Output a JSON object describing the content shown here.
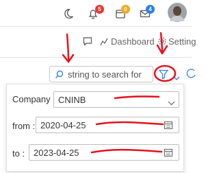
{
  "header": {
    "badges": {
      "notifications": "5",
      "tasks": "0",
      "messages": "4"
    },
    "badge_colors": {
      "notifications": "#e53935",
      "tasks": "#f5a623",
      "messages": "#2f80ed"
    }
  },
  "nav": {
    "dashboard_label": "Dashboard",
    "settings_label": "Setting"
  },
  "search": {
    "placeholder": "string to search for"
  },
  "filters": {
    "company_label": "Company :",
    "company_value": "CNINB",
    "from_label": "from :",
    "from_value": "2020-04-25",
    "to_label": "to :",
    "to_value": "2023-04-25"
  },
  "icons": [
    "moon-icon",
    "bell-icon",
    "calendar-icon",
    "mail-icon",
    "avatar",
    "chat-icon",
    "dashboard-icon",
    "settings-icon",
    "search-icon",
    "filter-icon",
    "chevron-down-icon",
    "refresh-icon",
    "calendar-icon"
  ],
  "colors": {
    "annotation": "#e8101d"
  }
}
